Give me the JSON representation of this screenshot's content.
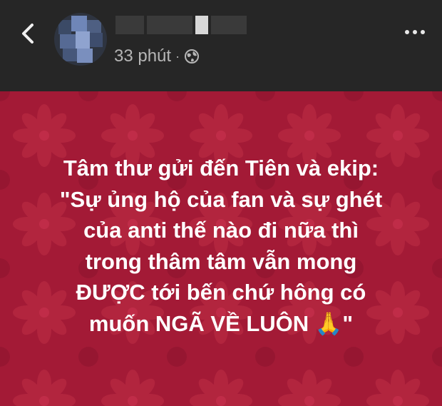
{
  "header": {
    "back_icon": "chevron-left-icon",
    "timestamp": "33 phút",
    "separator": "·",
    "privacy_icon": "globe-icon",
    "more_icon": "more-horizontal-icon"
  },
  "post": {
    "background_color": "#a31a36",
    "lines": [
      "Tâm thư gửi đến Tiên và ekip:",
      "\"Sự ủng hộ của fan và sự ghét",
      "của anti thế nào đi nữa thì",
      "trong thâm tâm vẫn mong",
      "ĐƯỢC tới bến chứ hông có",
      "muốn NGÃ VỀ LUÔN 🙏\""
    ]
  }
}
